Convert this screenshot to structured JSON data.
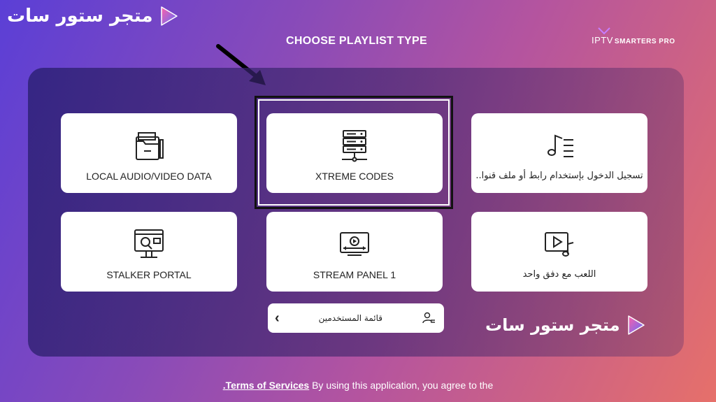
{
  "brand": {
    "text": "متجر ستور سات"
  },
  "page": {
    "title": "CHOOSE PLAYLIST TYPE"
  },
  "logo": {
    "text": "IPTV",
    "suffix": "SMARTERS PRO"
  },
  "cards": [
    {
      "label": "LOCAL AUDIO/VIDEO DATA",
      "icon": "folder-icon"
    },
    {
      "label": "XTREME CODES",
      "icon": "server-icon"
    },
    {
      "label": "تسجيل الدخول بإستخدام رابط أو ملف قنوا..",
      "icon": "music-list-icon"
    },
    {
      "label": "STALKER PORTAL",
      "icon": "monitor-search-icon"
    },
    {
      "label": "STREAM PANEL 1",
      "icon": "tv-play-icon"
    },
    {
      "label": "اللعب مع دفق واحد",
      "icon": "video-music-icon"
    }
  ],
  "users_button": {
    "label": "قائمة المستخدمين"
  },
  "footer": {
    "tos_link": "Terms of Services",
    "dot": ".",
    "text": "By using this application, you agree to the"
  },
  "colors": {
    "accent_play_start": "#ff4fa0",
    "accent_play_end": "#4f6bff"
  }
}
